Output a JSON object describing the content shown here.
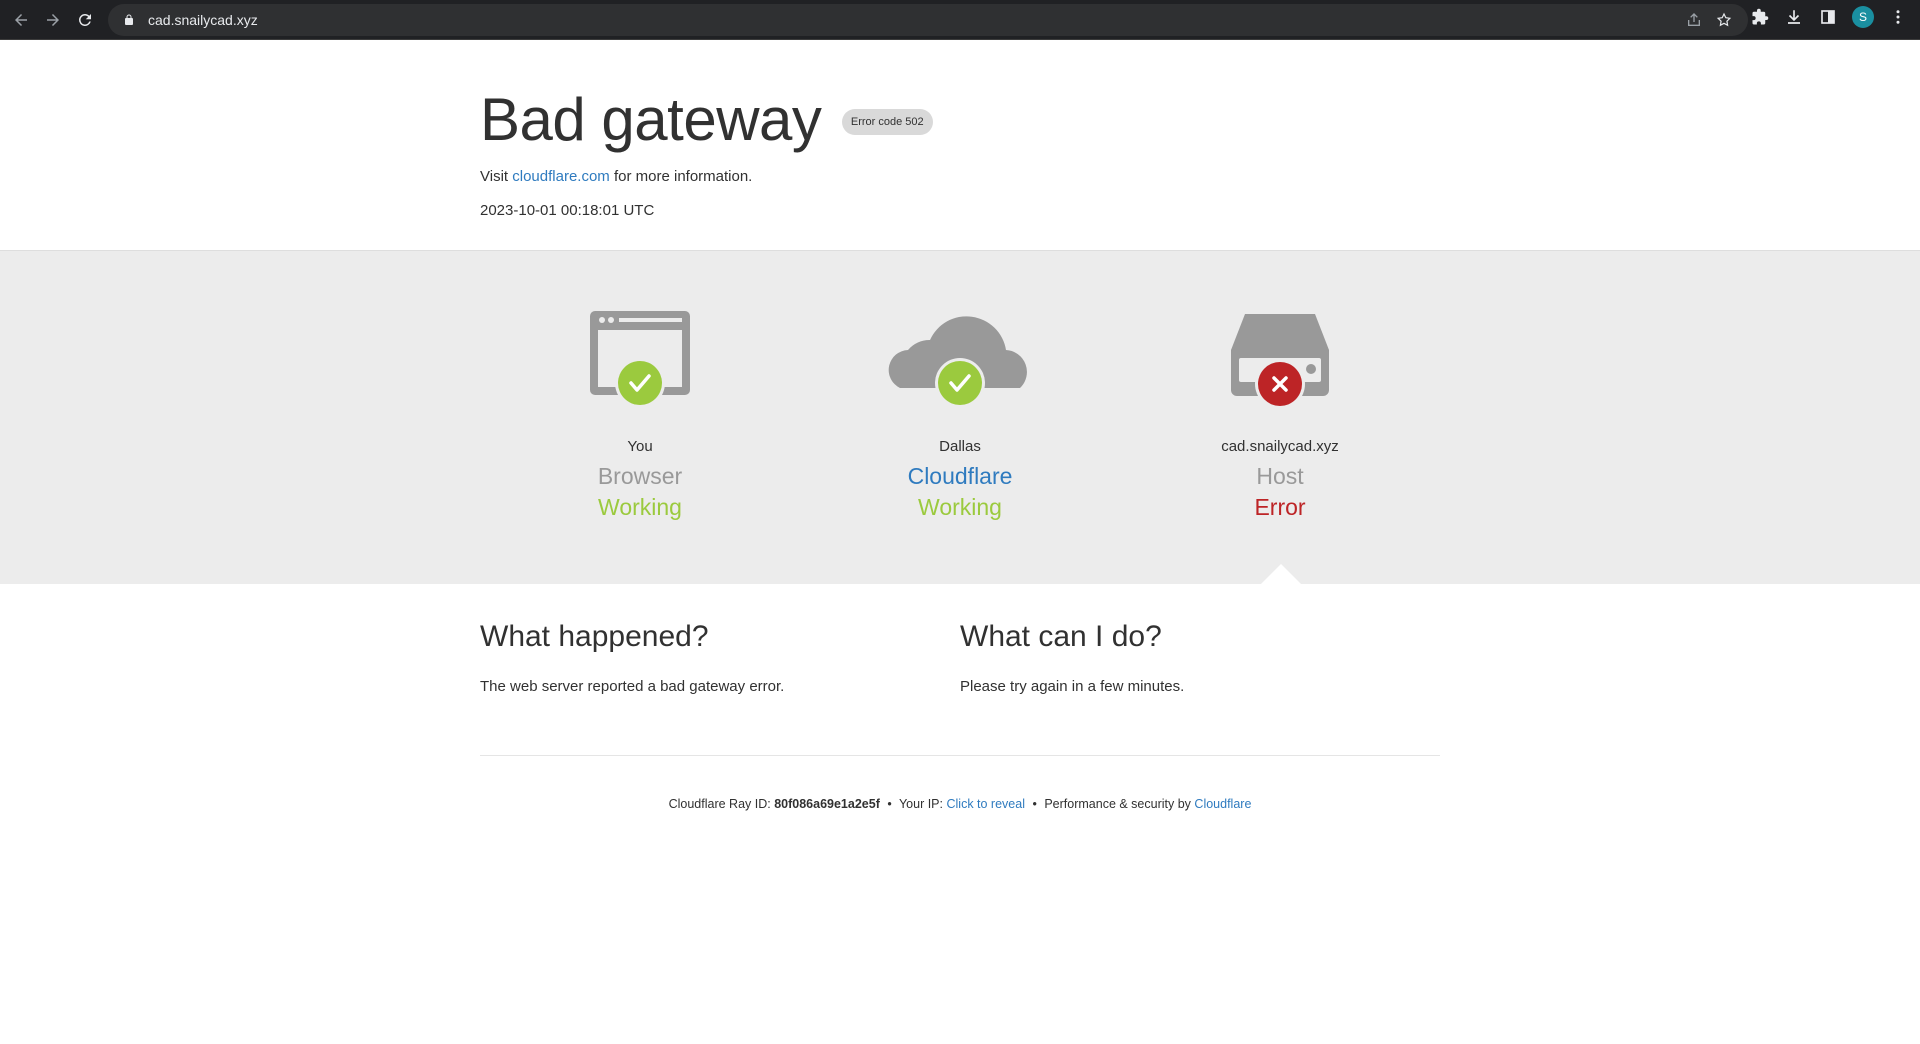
{
  "browser": {
    "url": "cad.snailycad.xyz",
    "profile_initial": "S"
  },
  "header": {
    "title": "Bad gateway",
    "error_badge": "Error code 502",
    "visit_prefix": "Visit",
    "visit_link": "cloudflare.com",
    "visit_suffix": "for more information.",
    "timestamp": "2023-10-01 00:18:01 UTC"
  },
  "diagnostics": [
    {
      "location": "You",
      "what": "Browser",
      "status": "Working",
      "state": "ok",
      "icon": "browser-icon"
    },
    {
      "location": "Dallas",
      "what": "Cloudflare",
      "status": "Working",
      "state": "ok",
      "icon": "cloud-icon"
    },
    {
      "location": "cad.snailycad.xyz",
      "what": "Host",
      "status": "Error",
      "state": "error",
      "icon": "server-icon"
    }
  ],
  "info": {
    "happened_title": "What happened?",
    "happened_text": "The web server reported a bad gateway error.",
    "cando_title": "What can I do?",
    "cando_text": "Please try again in a few minutes."
  },
  "footer": {
    "ray_label": "Cloudflare Ray ID:",
    "ray_id": "80f086a69e1a2e5f",
    "ip_label": "Your IP:",
    "ip_link": "Click to reveal",
    "perf_label": "Performance & security by",
    "perf_link": "Cloudflare",
    "separator": "•"
  },
  "colors": {
    "ok": "#9bca3e",
    "error": "#bd2426",
    "link": "#2f7bbf",
    "icon_gray": "#999999",
    "band": "#ececec"
  }
}
